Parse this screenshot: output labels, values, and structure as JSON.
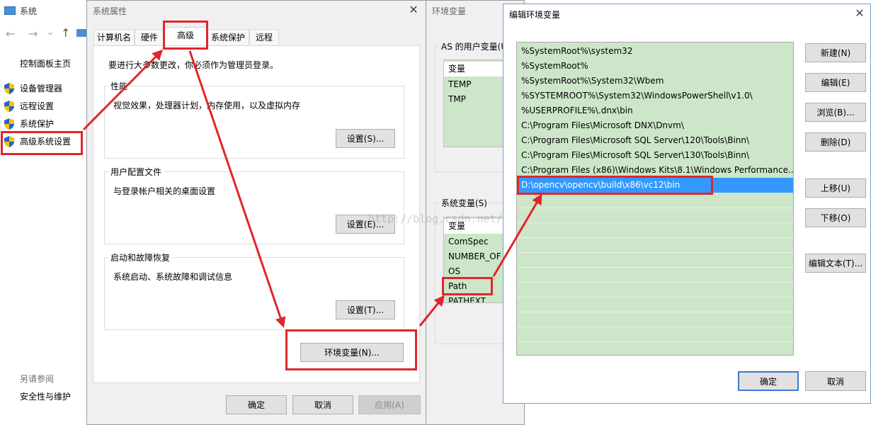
{
  "system_window": {
    "title": "系统",
    "nav_arrows": [
      "←",
      "→",
      "⌄",
      "↑"
    ],
    "control_panel_home": "控制面板主页",
    "items": [
      {
        "label": "设备管理器"
      },
      {
        "label": "远程设置"
      },
      {
        "label": "系统保护"
      },
      {
        "label": "高级系统设置"
      }
    ],
    "see_also": "另请参阅",
    "security": "安全性与维护"
  },
  "props_dialog": {
    "title": "系统属性",
    "close": "✕",
    "tabs": [
      "计算机名",
      "硬件",
      "高级",
      "系统保护",
      "远程"
    ],
    "admin_note": "要进行大多数更改，你必须作为管理员登录。",
    "performance": {
      "label": "性能",
      "desc": "视觉效果，处理器计划，内存使用，以及虚拟内存",
      "button": "设置(S)..."
    },
    "user_profile": {
      "label": "用户配置文件",
      "desc": "与登录帐户相关的桌面设置",
      "button": "设置(E)..."
    },
    "startup": {
      "label": "启动和故障恢复",
      "desc": "系统启动、系统故障和调试信息",
      "button": "设置(T)..."
    },
    "env_button": "环境变量(N)...",
    "ok": "确定",
    "cancel": "取消",
    "apply": "应用(A)"
  },
  "env_dialog": {
    "title": "环境变量",
    "user_vars_label": "AS 的用户变量(U)",
    "user_header": "变量",
    "user_vars": [
      "TEMP",
      "TMP"
    ],
    "sys_vars_label": "系统变量(S)",
    "sys_header": "变量",
    "sys_vars": [
      "ComSpec",
      "NUMBER_OF",
      "OS",
      "Path",
      "PATHEXT"
    ]
  },
  "edit_dialog": {
    "title": "编辑环境变量",
    "close": "✕",
    "paths": [
      "%SystemRoot%\\system32",
      "%SystemRoot%",
      "%SystemRoot%\\System32\\Wbem",
      "%SYSTEMROOT%\\System32\\WindowsPowerShell\\v1.0\\",
      "%USERPROFILE%\\.dnx\\bin",
      "C:\\Program Files\\Microsoft DNX\\Dnvm\\",
      "C:\\Program Files\\Microsoft SQL Server\\120\\Tools\\Binn\\",
      "C:\\Program Files\\Microsoft SQL Server\\130\\Tools\\Binn\\",
      "C:\\Program Files (x86)\\Windows Kits\\8.1\\Windows Performance...",
      "D:\\opencv\\opencv\\build\\x86\\vc12\\bin"
    ],
    "selected_index": 9,
    "buttons": {
      "new": "新建(N)",
      "edit": "编辑(E)",
      "browse": "浏览(B)...",
      "delete": "删除(D)",
      "up": "上移(U)",
      "down": "下移(O)",
      "edit_text": "编辑文本(T)..."
    },
    "ok": "确定",
    "cancel": "取消"
  },
  "watermark": "http://blog.csdn.net/",
  "colors": {
    "annotation_red": "#e0262b",
    "list_green": "#cde6c9",
    "selection_blue": "#3399ff",
    "primary_border": "#3d7bcf"
  }
}
